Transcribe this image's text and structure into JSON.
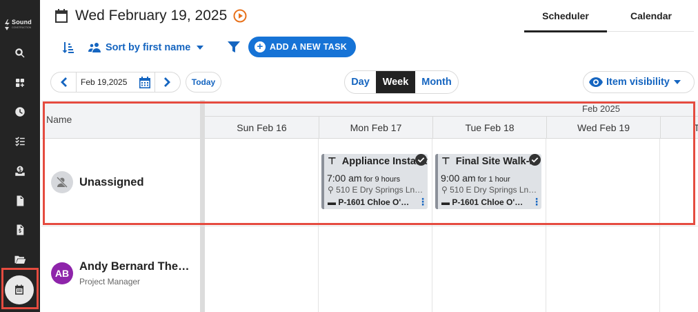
{
  "sidebar": {
    "brand": "Sound",
    "tagline": "CONSTRUCTION",
    "items": [
      {
        "icon": "search-icon"
      },
      {
        "icon": "dashboard-add-icon"
      },
      {
        "icon": "clock-icon"
      },
      {
        "icon": "checklist-icon"
      },
      {
        "icon": "money-inbox-icon"
      },
      {
        "icon": "document-icon"
      },
      {
        "icon": "invoice-icon"
      },
      {
        "icon": "folder-icon"
      },
      {
        "icon": "calendar-icon",
        "active": true
      }
    ]
  },
  "header": {
    "date_title": "Wed February 19, 2025",
    "tabs": [
      {
        "label": "Scheduler",
        "active": true
      },
      {
        "label": "Calendar",
        "active": false
      }
    ]
  },
  "toolbar": {
    "sort_label": "Sort by first name",
    "add_task_label": "ADD A NEW TASK",
    "date_input_value": "Feb 19,2025",
    "today_label": "Today",
    "views": [
      "Day",
      "Week",
      "Month"
    ],
    "active_view": "Week",
    "visibility_label": "Item visibility"
  },
  "grid": {
    "name_header": "Name",
    "month_label": "Feb 2025",
    "days": [
      "Sun Feb 16",
      "Mon Feb 17",
      "Tue Feb 18",
      "Wed Feb 19",
      "T"
    ],
    "rows": [
      {
        "name": "Unassigned",
        "subtitle": ""
      },
      {
        "name": "Andy Bernard The…",
        "initials": "AB",
        "subtitle": "Project Manager"
      }
    ],
    "tasks": [
      {
        "title": "Appliance Installation",
        "time": "7:00 am",
        "duration": "for 9 hours",
        "address": "510 E Dry Springs Ln…",
        "project": "P-1601 Chloe O'…"
      },
      {
        "title": "Final Site Walk-In",
        "time": "9:00 am",
        "duration": "for 1 hour",
        "address": "510 E Dry Springs Ln…",
        "project": "P-1601 Chloe O'…"
      }
    ]
  },
  "colors": {
    "accent": "#1673d6",
    "sidebar_bg": "#242424",
    "highlight": "#e54b3f",
    "task_bg": "#dfe2e6",
    "avatar_purple": "#8e24aa"
  }
}
